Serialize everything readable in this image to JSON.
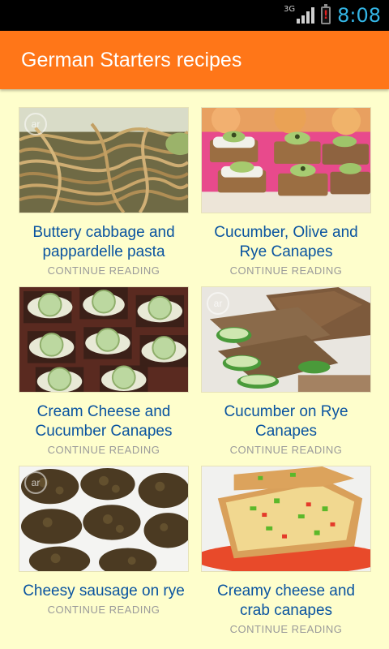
{
  "status_bar": {
    "network": "3G",
    "time": "8:08",
    "colors": {
      "clock": "#33b5e5",
      "battery_warning": "#e02020"
    }
  },
  "app_bar": {
    "title": "German Starters recipes",
    "color": "#ff7618"
  },
  "recipes": [
    {
      "title": "Buttery cabbage and pappardelle pasta",
      "link": "CONTINUE READING",
      "image": "pasta-noodles-image"
    },
    {
      "title": "Cucumber, Olive and Rye Canapes",
      "link": "CONTINUE READING",
      "image": "cucumber-olive-canapes-image"
    },
    {
      "title": "Cream Cheese and Cucumber Canapes",
      "link": "CONTINUE READING",
      "image": "cream-cheese-cucumber-canapes-image"
    },
    {
      "title": "Cucumber on Rye Canapes",
      "link": "CONTINUE READING",
      "image": "cucumber-rye-canapes-image"
    },
    {
      "title": "Cheesy sausage on rye",
      "link": "CONTINUE READING",
      "image": "cheesy-sausage-rye-image"
    },
    {
      "title": "Creamy cheese and crab canapes",
      "link": "CONTINUE READING",
      "image": "crab-canapes-image"
    }
  ],
  "colors": {
    "background": "#fefecc",
    "title_text": "#0a54a0",
    "link_text": "#9a9a9a"
  }
}
